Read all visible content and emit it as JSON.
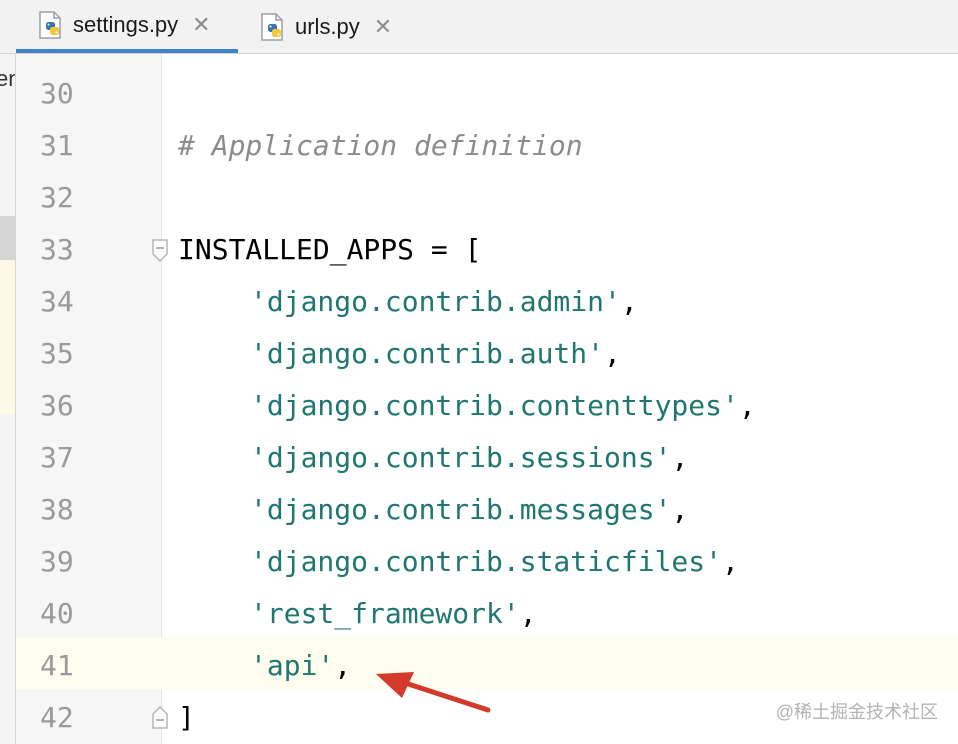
{
  "tabs": [
    {
      "label": "settings.py",
      "icon": "python-file-icon",
      "active": true
    },
    {
      "label": "urls.py",
      "icon": "python-file-icon",
      "active": false
    }
  ],
  "project_panel_fragment": "en",
  "editor": {
    "lines": [
      {
        "number": "30",
        "text": ""
      },
      {
        "number": "31",
        "text": "# Application definition"
      },
      {
        "number": "32",
        "text": ""
      },
      {
        "number": "33",
        "text": "INSTALLED_APPS = ["
      },
      {
        "number": "34",
        "string": "'django.contrib.admin'",
        "suffix": ","
      },
      {
        "number": "35",
        "string": "'django.contrib.auth'",
        "suffix": ","
      },
      {
        "number": "36",
        "string": "'django.contrib.contenttypes'",
        "suffix": ","
      },
      {
        "number": "37",
        "string": "'django.contrib.sessions'",
        "suffix": ","
      },
      {
        "number": "38",
        "string": "'django.contrib.messages'",
        "suffix": ","
      },
      {
        "number": "39",
        "string": "'django.contrib.staticfiles'",
        "suffix": ","
      },
      {
        "number": "40",
        "string": "'rest_framework'",
        "suffix": ","
      },
      {
        "number": "41",
        "string": "'api'",
        "suffix": ","
      },
      {
        "number": "42",
        "text": "]"
      }
    ],
    "current_line": "41"
  },
  "colors": {
    "string": "#1f7770",
    "comment": "#8c8c8c",
    "line_number": "#9a9a9a",
    "tab_active_underline": "#4083c9",
    "arrow": "#d23a2a"
  },
  "watermark": "@稀土掘金技术社区"
}
